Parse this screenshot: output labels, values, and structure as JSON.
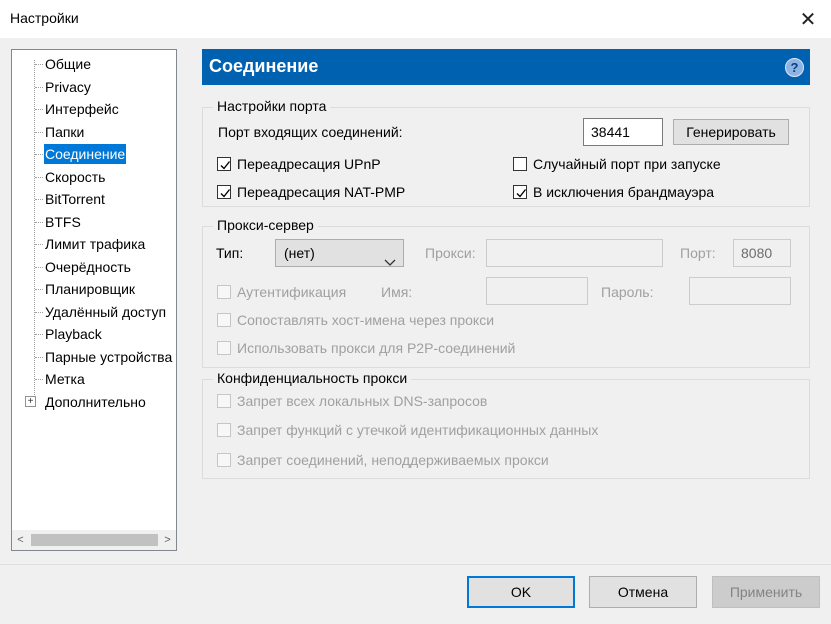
{
  "window": {
    "title": "Настройки",
    "close_glyph": "✕"
  },
  "tree": {
    "items": [
      {
        "label": "Общие"
      },
      {
        "label": "Privacy"
      },
      {
        "label": "Интерфейс"
      },
      {
        "label": "Папки"
      },
      {
        "label": "Соединение",
        "selected": true
      },
      {
        "label": "Скорость"
      },
      {
        "label": "BitTorrent"
      },
      {
        "label": "BTFS"
      },
      {
        "label": "Лимит трафика"
      },
      {
        "label": "Очерёдность"
      },
      {
        "label": "Планировщик"
      },
      {
        "label": "Удалённый доступ"
      },
      {
        "label": "Playback"
      },
      {
        "label": "Парные устройства"
      },
      {
        "label": "Метка"
      },
      {
        "label": "Дополнительно",
        "expandable": true
      }
    ],
    "expander_glyph": "+",
    "scroll_left": "<",
    "scroll_right": ">"
  },
  "page": {
    "title": "Соединение",
    "help_glyph": "?"
  },
  "port": {
    "legend": "Настройки порта",
    "incoming_label": "Порт входящих соединений:",
    "incoming_value": "38441",
    "generate_label": "Генерировать",
    "upnp": {
      "label": "Переадресация UPnP",
      "checked": true
    },
    "natpmp": {
      "label": "Переадресация NAT-PMP",
      "checked": true
    },
    "random": {
      "label": "Случайный порт при запуске",
      "checked": false
    },
    "firewall": {
      "label": "В исключения брандмауэра",
      "checked": true
    }
  },
  "proxy": {
    "legend": "Прокси-сервер",
    "type_label": "Тип:",
    "type_value": "(нет)",
    "proxy_label": "Прокси:",
    "proxy_value": "",
    "port_label": "Порт:",
    "port_value": "8080",
    "auth_label": "Аутентификация",
    "name_label": "Имя:",
    "name_value": "",
    "password_label": "Пароль:",
    "password_value": "",
    "resolve_label": "Сопоставлять хост-имена через прокси",
    "p2p_label": "Использовать прокси для P2P-соединений"
  },
  "privacy": {
    "legend": "Конфиденциальность прокси",
    "dns_label": "Запрет всех локальных DNS-запросов",
    "leak_label": "Запрет функций с утечкой идентификационных данных",
    "unsupported_label": "Запрет соединений, неподдерживаемых прокси"
  },
  "footer": {
    "ok": "OK",
    "cancel": "Отмена",
    "apply": "Применить"
  },
  "colors": {
    "header": "#0061b0",
    "selection": "#0078d7"
  }
}
